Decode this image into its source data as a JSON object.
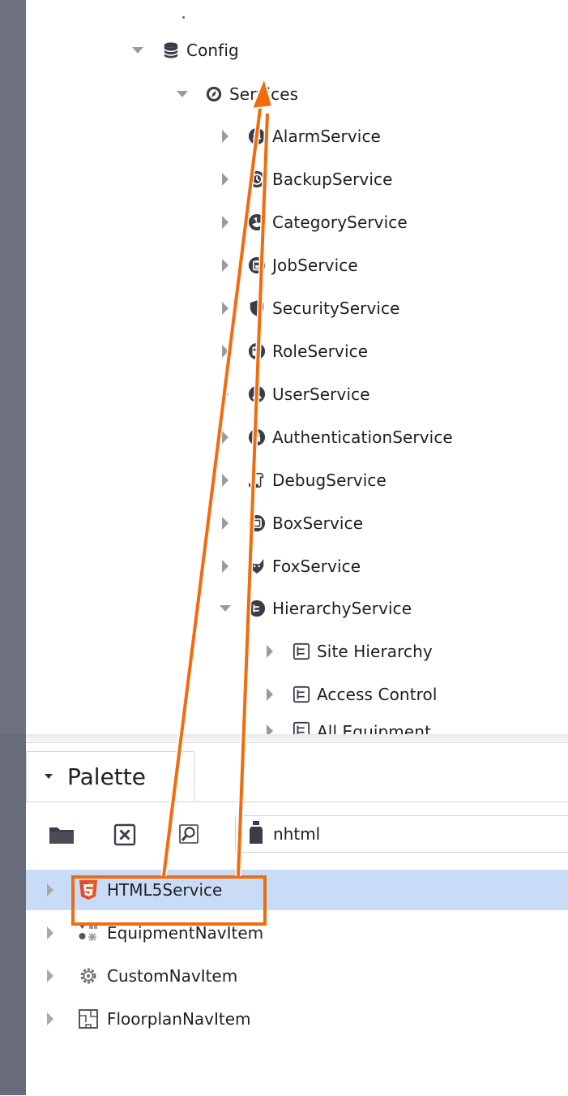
{
  "tree": {
    "config": {
      "label": "Config",
      "icon": "database-icon"
    },
    "services": {
      "label": "Services",
      "icon": "services-icon"
    },
    "items": [
      {
        "label": "AlarmService",
        "icon": "bell-icon"
      },
      {
        "label": "BackupService",
        "icon": "history-icon"
      },
      {
        "label": "CategoryService",
        "icon": "category-icon"
      },
      {
        "label": "JobService",
        "icon": "job-icon"
      },
      {
        "label": "SecurityService",
        "icon": "shield-icon"
      },
      {
        "label": "RoleService",
        "icon": "role-icon"
      },
      {
        "label": "UserService",
        "icon": "user-icon"
      },
      {
        "label": "AuthenticationService",
        "icon": "lock-icon"
      },
      {
        "label": "DebugService",
        "icon": "scroll-icon"
      },
      {
        "label": "BoxService",
        "icon": "box-icon"
      },
      {
        "label": "FoxService",
        "icon": "fox-icon"
      },
      {
        "label": "HierarchyService",
        "icon": "hierarchy-icon"
      }
    ],
    "hierarchy_children": [
      {
        "label": "Site Hierarchy",
        "icon": "hierarchy-def-icon"
      },
      {
        "label": "Access Control",
        "icon": "hierarchy-def-icon"
      },
      {
        "label": "All Equipment",
        "icon": "hierarchy-def-icon"
      }
    ]
  },
  "palette": {
    "title": "Palette",
    "module_value": "nhtml",
    "items": [
      {
        "label": "HTML5Service",
        "icon": "html5-icon",
        "selected": true
      },
      {
        "label": "EquipmentNavItem",
        "icon": "equipment-nav-icon",
        "selected": false
      },
      {
        "label": "CustomNavItem",
        "icon": "gear-icon",
        "selected": false
      },
      {
        "label": "FloorplanNavItem",
        "icon": "floorplan-icon",
        "selected": false
      }
    ]
  },
  "colors": {
    "accent_orange": "#f26b0c",
    "selection": "#c9dcf7",
    "rail": "#6d7180"
  }
}
